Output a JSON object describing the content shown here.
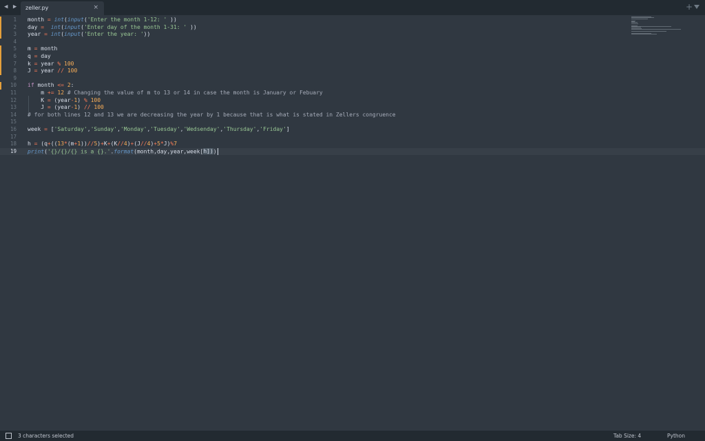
{
  "tabs": {
    "nav_arrows": "◀ ▶",
    "active_file": "zeller.py",
    "close": "×",
    "new_tab": "+"
  },
  "lines": [
    {
      "n": "1",
      "modified": true,
      "segments": [
        [
          "month ",
          "v"
        ],
        [
          "=",
          "op"
        ],
        [
          " ",
          "v"
        ],
        [
          "int",
          "fn"
        ],
        [
          "(",
          "br"
        ],
        [
          "input",
          "fn"
        ],
        [
          "(",
          "br"
        ],
        [
          "'Enter the month 1-12: '",
          "str"
        ],
        [
          " ))",
          "br"
        ]
      ]
    },
    {
      "n": "2",
      "modified": true,
      "segments": [
        [
          "day ",
          "v"
        ],
        [
          "=",
          "op"
        ],
        [
          "  ",
          "v"
        ],
        [
          "int",
          "fn"
        ],
        [
          "(",
          "br"
        ],
        [
          "input",
          "fn"
        ],
        [
          "(",
          "br"
        ],
        [
          "'Enter day of the month 1-31: '",
          "str"
        ],
        [
          " ))",
          "br"
        ]
      ]
    },
    {
      "n": "3",
      "modified": true,
      "segments": [
        [
          "year ",
          "v"
        ],
        [
          "=",
          "op"
        ],
        [
          " ",
          "v"
        ],
        [
          "int",
          "fn"
        ],
        [
          "(",
          "br"
        ],
        [
          "input",
          "fn"
        ],
        [
          "(",
          "br"
        ],
        [
          "'Enter the year: '",
          "str"
        ],
        [
          "))",
          "br"
        ]
      ]
    },
    {
      "n": "4",
      "modified": false,
      "segments": []
    },
    {
      "n": "5",
      "modified": true,
      "segments": [
        [
          "m ",
          "v"
        ],
        [
          "=",
          "op"
        ],
        [
          " month",
          "v"
        ]
      ]
    },
    {
      "n": "6",
      "modified": true,
      "segments": [
        [
          "q ",
          "v"
        ],
        [
          "=",
          "op"
        ],
        [
          " day",
          "v"
        ]
      ]
    },
    {
      "n": "7",
      "modified": true,
      "segments": [
        [
          "k ",
          "v"
        ],
        [
          "=",
          "op"
        ],
        [
          " year ",
          "v"
        ],
        [
          "%",
          "op"
        ],
        [
          " ",
          "v"
        ],
        [
          "100",
          "num"
        ]
      ]
    },
    {
      "n": "8",
      "modified": true,
      "segments": [
        [
          "J ",
          "v"
        ],
        [
          "=",
          "op"
        ],
        [
          " year ",
          "v"
        ],
        [
          "//",
          "op"
        ],
        [
          " ",
          "v"
        ],
        [
          "100",
          "num"
        ]
      ]
    },
    {
      "n": "9",
      "modified": false,
      "segments": []
    },
    {
      "n": "10",
      "modified": true,
      "segments": [
        [
          "if",
          "kw"
        ],
        [
          " month ",
          "v"
        ],
        [
          "<=",
          "op"
        ],
        [
          " ",
          "v"
        ],
        [
          "2",
          "num"
        ],
        [
          ":",
          "v"
        ]
      ]
    },
    {
      "n": "11",
      "modified": false,
      "segments": [
        [
          "    m ",
          "v"
        ],
        [
          "+=",
          "op"
        ],
        [
          " ",
          "v"
        ],
        [
          "12",
          "num"
        ],
        [
          " ",
          "v"
        ],
        [
          "# Changing the value of m to 13 or 14 in case the month is January or Febuary",
          "cm"
        ]
      ]
    },
    {
      "n": "12",
      "modified": false,
      "segments": [
        [
          "    K ",
          "v"
        ],
        [
          "=",
          "op"
        ],
        [
          " (year",
          "v"
        ],
        [
          "-",
          "op"
        ],
        [
          "1",
          "num"
        ],
        [
          ") ",
          "v"
        ],
        [
          "%",
          "op"
        ],
        [
          " ",
          "v"
        ],
        [
          "100",
          "num"
        ]
      ]
    },
    {
      "n": "13",
      "modified": false,
      "segments": [
        [
          "    J ",
          "v"
        ],
        [
          "=",
          "op"
        ],
        [
          " (year",
          "v"
        ],
        [
          "-",
          "op"
        ],
        [
          "1",
          "num"
        ],
        [
          ") ",
          "v"
        ],
        [
          "//",
          "op"
        ],
        [
          " ",
          "v"
        ],
        [
          "100",
          "num"
        ]
      ]
    },
    {
      "n": "14",
      "modified": false,
      "segments": [
        [
          "# for both lines 12 and 13 we are decreasing the year by 1 because that is what is stated in Zellers congruence",
          "cm"
        ]
      ]
    },
    {
      "n": "15",
      "modified": false,
      "segments": []
    },
    {
      "n": "16",
      "modified": false,
      "segments": [
        [
          "week ",
          "v"
        ],
        [
          "=",
          "op"
        ],
        [
          " [",
          "v"
        ],
        [
          "'Saturday'",
          "str"
        ],
        [
          ",",
          "v"
        ],
        [
          "'Sunday'",
          "str"
        ],
        [
          ",",
          "v"
        ],
        [
          "'Monday'",
          "str"
        ],
        [
          ",",
          "v"
        ],
        [
          "'Tuesday'",
          "str"
        ],
        [
          ",",
          "v"
        ],
        [
          "'Wedsenday'",
          "str"
        ],
        [
          ",",
          "v"
        ],
        [
          "'Thursday'",
          "str"
        ],
        [
          ",",
          "v"
        ],
        [
          "'Friday'",
          "str"
        ],
        [
          "]",
          "v"
        ]
      ]
    },
    {
      "n": "17",
      "modified": false,
      "segments": []
    },
    {
      "n": "18",
      "modified": false,
      "segments": [
        [
          "h ",
          "v"
        ],
        [
          "=",
          "op"
        ],
        [
          " (q",
          "v"
        ],
        [
          "+",
          "op"
        ],
        [
          "((",
          "v"
        ],
        [
          "13",
          "num"
        ],
        [
          "*",
          "op"
        ],
        [
          "(m",
          "v"
        ],
        [
          "+",
          "op"
        ],
        [
          "1",
          "num"
        ],
        [
          "))",
          "v"
        ],
        [
          "//",
          "op"
        ],
        [
          "5",
          "num"
        ],
        [
          ")",
          "v"
        ],
        [
          "+",
          "op"
        ],
        [
          "K",
          "v"
        ],
        [
          "+",
          "op"
        ],
        [
          "(K",
          "v"
        ],
        [
          "//",
          "op"
        ],
        [
          "4",
          "num"
        ],
        [
          ")",
          "v"
        ],
        [
          "+",
          "op"
        ],
        [
          "(J",
          "v"
        ],
        [
          "//",
          "op"
        ],
        [
          "4",
          "num"
        ],
        [
          ")",
          "v"
        ],
        [
          "+",
          "op"
        ],
        [
          "5",
          "num"
        ],
        [
          "*",
          "op"
        ],
        [
          "J)",
          "v"
        ],
        [
          "%",
          "op"
        ],
        [
          "7",
          "num"
        ]
      ]
    },
    {
      "n": "19",
      "modified": false,
      "active": true,
      "segments": [
        [
          "print",
          "fn"
        ],
        [
          "(",
          "br"
        ],
        [
          "'{}/{}/{} is a {}.'",
          "str"
        ],
        [
          ".",
          "v"
        ],
        [
          "format",
          "fn"
        ],
        [
          "(month,day,year,week[",
          "v"
        ],
        [
          "h])",
          "sel"
        ],
        [
          ")",
          "br"
        ]
      ]
    }
  ],
  "status": {
    "selection": "3 characters selected",
    "tab_size": "Tab Size: 4",
    "language": "Python"
  },
  "colors": {
    "background": "#303841",
    "keyword": "#c594c5",
    "function": "#6699cc",
    "operator": "#f97b58",
    "string": "#99c794",
    "number": "#f9ae58",
    "comment": "#a6acb9",
    "modified_marker": "#e5a03b"
  }
}
